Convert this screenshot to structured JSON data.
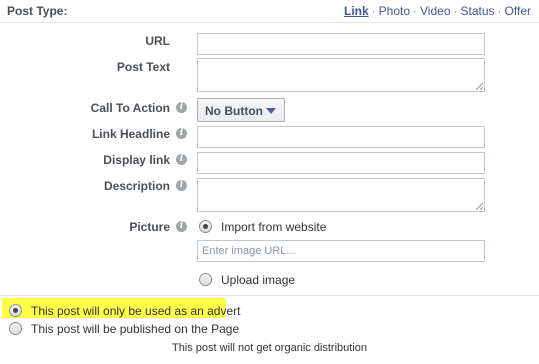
{
  "header": {
    "title": "Post Type:",
    "types": [
      "Link",
      "Photo",
      "Video",
      "Status",
      "Offer"
    ],
    "separator": "·"
  },
  "form": {
    "url_label": "URL",
    "post_text_label": "Post Text",
    "cta_label": "Call To Action",
    "cta_value": "No Button",
    "headline_label": "Link Headline",
    "display_link_label": "Display link",
    "description_label": "Description",
    "picture_label": "Picture",
    "import_option": "Import from website",
    "image_url_placeholder": "Enter image URL...",
    "upload_option": "Upload image",
    "info_glyph": "i"
  },
  "distribution": {
    "advert_option": "This post will only be used as an advert",
    "page_option": "This post will be published on the Page",
    "note": "This post will not get organic distribution",
    "selected": "advert"
  },
  "colors": {
    "link": "#3b5998",
    "highlight": "#ffff4a",
    "label": "#4b4f56"
  }
}
